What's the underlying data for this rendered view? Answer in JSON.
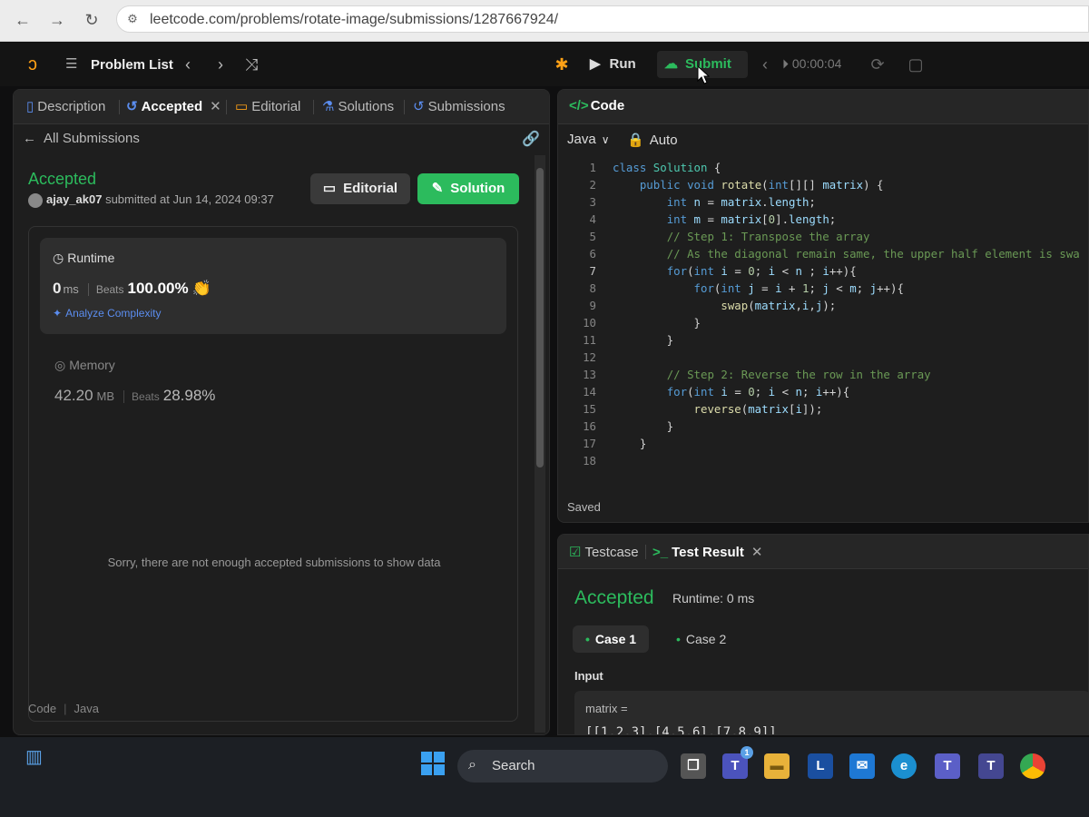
{
  "browser": {
    "url": "leetcode.com/problems/rotate-image/submissions/1287667924/"
  },
  "topbar": {
    "problem_list": "Problem List",
    "run": "Run",
    "submit": "Submit",
    "timer": "00:00:04"
  },
  "left": {
    "tabs": [
      {
        "label": "Description"
      },
      {
        "label": "Accepted"
      },
      {
        "label": "Editorial"
      },
      {
        "label": "Solutions"
      },
      {
        "label": "Submissions"
      }
    ],
    "all_submissions": "All Submissions",
    "status": "Accepted",
    "user": "ajay_ak07",
    "submitted_text": "submitted at Jun 14, 2024 09:37",
    "editorial_btn": "Editorial",
    "solution_btn": "Solution",
    "runtime": {
      "label": "Runtime",
      "value": "0",
      "unit": "ms",
      "beats_label": "Beats",
      "beats": "100.00%",
      "analyze": "Analyze Complexity"
    },
    "memory": {
      "label": "Memory",
      "value": "42.20",
      "unit": "MB",
      "beats_label": "Beats",
      "beats": "28.98%"
    },
    "empty_msg": "Sorry, there are not enough accepted submissions to show data",
    "code_label": "Code",
    "lang_label": "Java"
  },
  "code": {
    "title": "Code",
    "language": "Java",
    "mode": "Auto",
    "saved": "Saved"
  },
  "test": {
    "tab_testcase": "Testcase",
    "tab_result": "Test Result",
    "status": "Accepted",
    "runtime": "Runtime: 0 ms",
    "case1": "Case 1",
    "case2": "Case 2",
    "input_label": "Input",
    "param": "matrix =",
    "param_value": "[[1,2,3],[4,5,6],[7,8,9]]"
  },
  "taskbar": {
    "search": "Search"
  },
  "colors": {
    "accent_green": "#2cbb5d",
    "brand_orange": "#ffa116",
    "link_blue": "#5b8def"
  }
}
